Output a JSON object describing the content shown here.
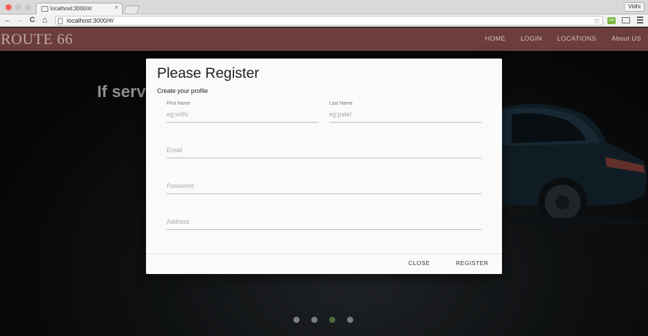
{
  "browser": {
    "tab_title": "localhost:3000/#/",
    "url": "localhost:3000/#/",
    "profile_name": "Vidhi",
    "extension_badge": "ON",
    "nav_icons": [
      "back-arrow-icon",
      "forward-arrow-icon",
      "reload-icon",
      "home-icon"
    ],
    "glyphs": {
      "back": "←",
      "forward": "→",
      "reload": "C",
      "home": "⌂",
      "star": "☆",
      "close": "×"
    }
  },
  "site": {
    "brand": "ROUTE 66",
    "nav": [
      "HOME",
      "LOGIN",
      "LOCATIONS",
      "About US"
    ],
    "hero_text": "If serv",
    "carousel": {
      "count": 4,
      "active_index": 2
    }
  },
  "modal": {
    "title": "Please Register",
    "subtitle": "Create your profile",
    "fields": {
      "first_name": {
        "label": "First Name",
        "placeholder": "eg:vidhi"
      },
      "last_name": {
        "label": "Last Name",
        "placeholder": "eg:patel"
      },
      "email": {
        "placeholder": "Email"
      },
      "password": {
        "placeholder": "Password"
      },
      "address": {
        "placeholder": "Address"
      }
    },
    "buttons": {
      "close": "CLOSE",
      "register": "REGISTER"
    }
  },
  "colors": {
    "navbar": "#6b3d3d",
    "brand_text": "#c0a7a1",
    "active_dot": "#4e6b46",
    "close_traffic_light": "#fc5f57"
  }
}
